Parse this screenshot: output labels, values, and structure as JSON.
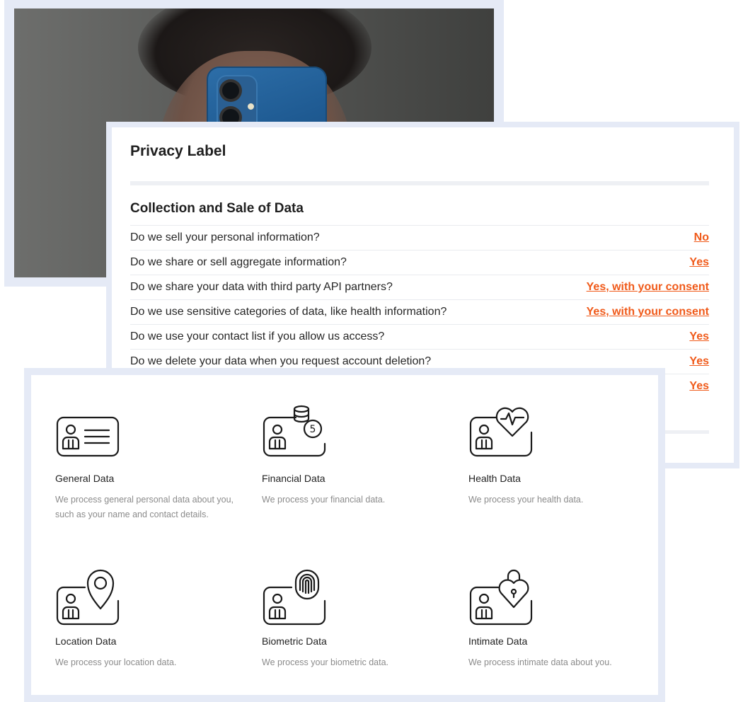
{
  "privacy_label": {
    "title": "Privacy Label",
    "section_title": "Collection and Sale of Data",
    "rows": [
      {
        "question": "Do we sell your personal information?",
        "answer": "No"
      },
      {
        "question": "Do we share or sell aggregate information?",
        "answer": "Yes"
      },
      {
        "question": "Do we share your data with third party API partners?",
        "answer": "Yes, with your consent"
      },
      {
        "question": "Do we use sensitive categories of data, like health information?",
        "answer": "Yes, with your consent"
      },
      {
        "question": "Do we use your contact list if you allow us access?",
        "answer": "Yes"
      },
      {
        "question": "Do we delete your data when you request account deletion?",
        "answer": "Yes"
      },
      {
        "question": "",
        "answer": "Yes"
      }
    ],
    "accent_color": "#f05a1a"
  },
  "data_categories": [
    {
      "title": "General Data",
      "description": "We process general personal data about you, such as your name and contact details.",
      "icon": "id-card-icon"
    },
    {
      "title": "Financial Data",
      "description": "We process your financial data.",
      "icon": "id-card-coins-icon"
    },
    {
      "title": "Health Data",
      "description": "We process your health data.",
      "icon": "id-card-heart-icon"
    },
    {
      "title": "Location Data",
      "description": "We process your location data.",
      "icon": "id-card-location-pin-icon"
    },
    {
      "title": "Biometric Data",
      "description": "We process your biometric data.",
      "icon": "id-card-fingerprint-icon"
    },
    {
      "title": "Intimate Data",
      "description": "We process intimate data about you.",
      "icon": "id-card-heart-lock-icon"
    }
  ]
}
